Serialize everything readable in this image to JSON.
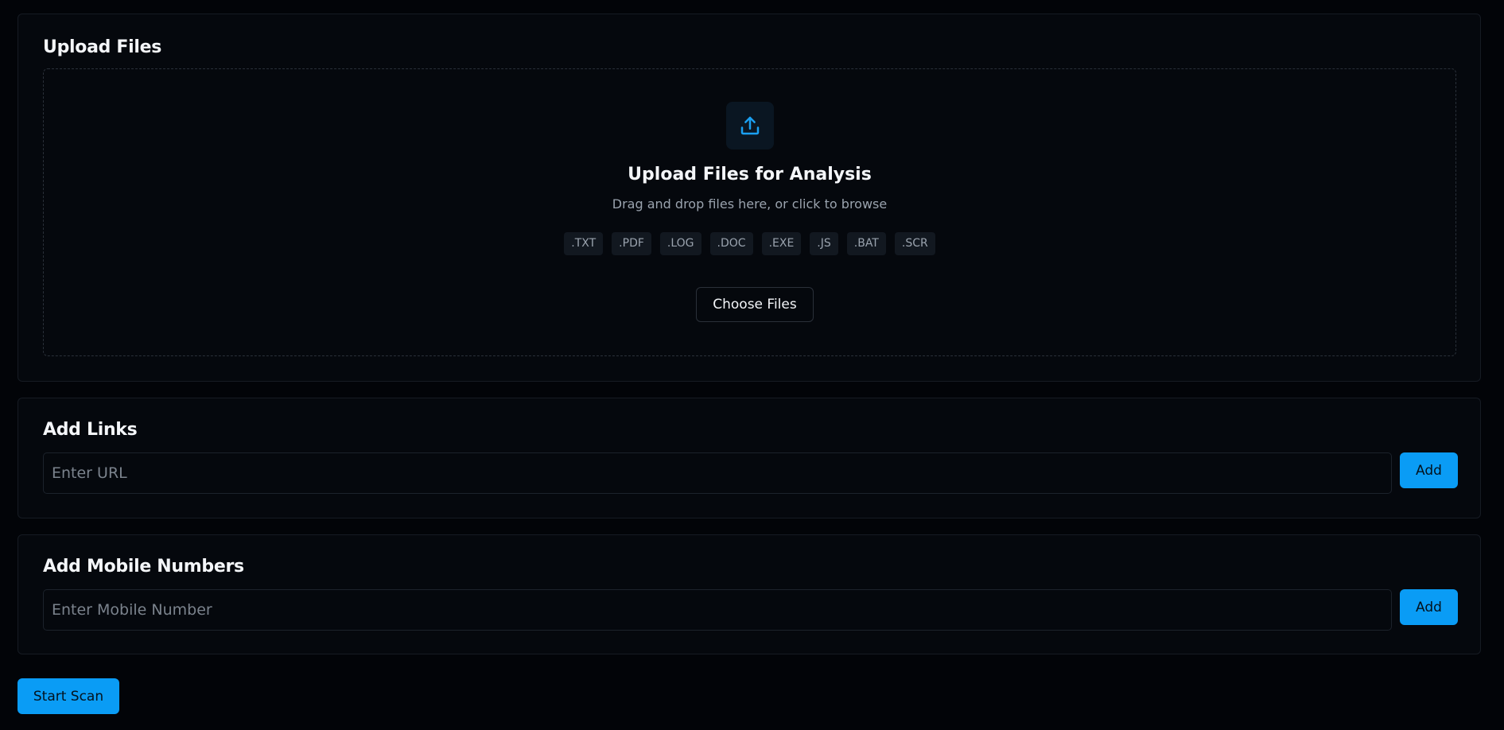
{
  "upload": {
    "title": "Upload Files",
    "icon": "upload-icon",
    "heading": "Upload Files for Analysis",
    "subtitle": "Drag and drop files here, or click to browse",
    "extensions": [
      ".TXT",
      ".PDF",
      ".LOG",
      ".DOC",
      ".EXE",
      ".JS",
      ".BAT",
      ".SCR"
    ],
    "choose_label": "Choose Files"
  },
  "links": {
    "title": "Add Links",
    "placeholder": "Enter URL",
    "value": "",
    "add_label": "Add"
  },
  "mobile": {
    "title": "Add Mobile Numbers",
    "placeholder": "Enter Mobile Number",
    "value": "",
    "add_label": "Add"
  },
  "scan": {
    "label": "Start Scan"
  },
  "colors": {
    "accent": "#0a9cf5",
    "background": "#020408",
    "card": "#05080d",
    "muted_text": "#9aa3ae"
  }
}
